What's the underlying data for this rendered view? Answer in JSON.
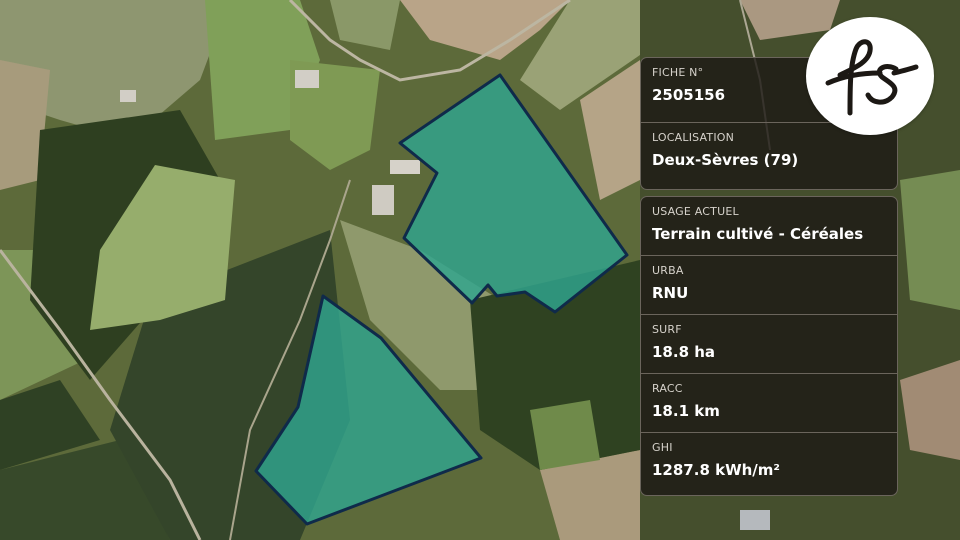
{
  "colors": {
    "parcel_fill": "#2fa58f",
    "parcel_stroke": "#0f2a4a",
    "panel_bg": "#1c1814",
    "label": "#d6d2cb",
    "value": "#ffffff"
  },
  "logo": {
    "text": "fs",
    "icon": "fs-logo-icon"
  },
  "fiche": {
    "label": "FICHE N°",
    "value": "2505156"
  },
  "localisation": {
    "label": "LOCALISATION",
    "value": "Deux-Sèvres (79)"
  },
  "usage": {
    "label": "USAGE ACTUEL",
    "value": "Terrain cultivé - Céréales"
  },
  "urba": {
    "label": "URBA",
    "value": "RNU"
  },
  "surf": {
    "label": "SURF",
    "value": "18.8 ha"
  },
  "racc": {
    "label": "RACC",
    "value": "18.1 km"
  },
  "ghi": {
    "label": "GHI",
    "value": "1287.8 kWh/m²"
  }
}
